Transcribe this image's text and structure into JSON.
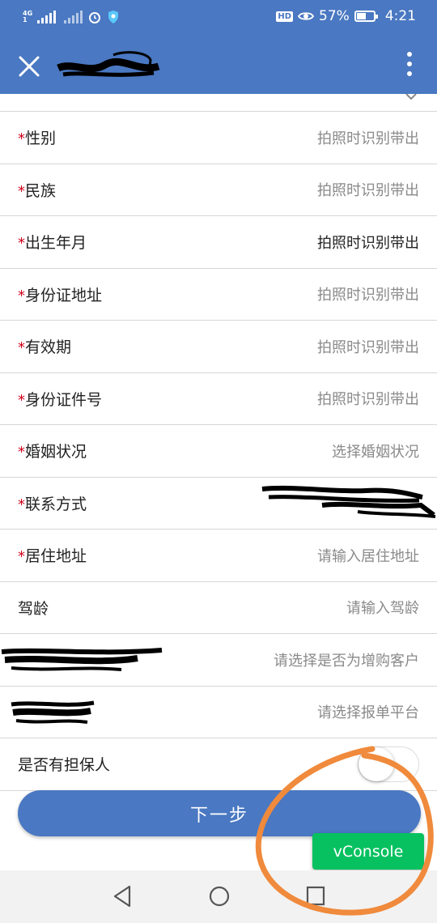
{
  "status_bar": {
    "network": "4G",
    "network_sub": "1",
    "battery": "57%",
    "battery_level": 0.57,
    "time": "4:21",
    "hd": "HD"
  },
  "navbar": {
    "close_icon": "close-icon",
    "more_icon": "more-vertical-icon"
  },
  "form": {
    "rows": [
      {
        "required": "*",
        "label": "性别",
        "value": "拍照时识别带出"
      },
      {
        "required": "*",
        "label": "民族",
        "value": "拍照时识别带出"
      },
      {
        "required": "*",
        "label": "出生年月",
        "value": "拍照时识别带出"
      },
      {
        "required": "*",
        "label": "身份证地址",
        "value": "拍照时识别带出"
      },
      {
        "required": "*",
        "label": "有效期",
        "value": "拍照时识别带出"
      },
      {
        "required": "*",
        "label": "身份证件号",
        "value": "拍照时识别带出"
      },
      {
        "required": "*",
        "label": "婚姻状况",
        "value": "选择婚姻状况"
      },
      {
        "required": "*",
        "label": "联系方式",
        "value": ""
      },
      {
        "required": "*",
        "label": "居住地址",
        "value": "请输入居住地址"
      },
      {
        "required": "",
        "label": "驾龄",
        "value": "请输入驾龄"
      },
      {
        "required": "",
        "label": "",
        "value": "请选择是否为增购客户"
      },
      {
        "required": "",
        "label": "",
        "value": "请选择报单平台"
      }
    ],
    "guarantor": {
      "label": "是否有担保人",
      "toggle_on": false
    }
  },
  "next_button": "下一步",
  "vconsole_button": "vConsole",
  "colors": {
    "primary": "#4a78c2",
    "required": "#d0021b",
    "vconsole": "#07c160",
    "annotation": "#f08a3c"
  }
}
